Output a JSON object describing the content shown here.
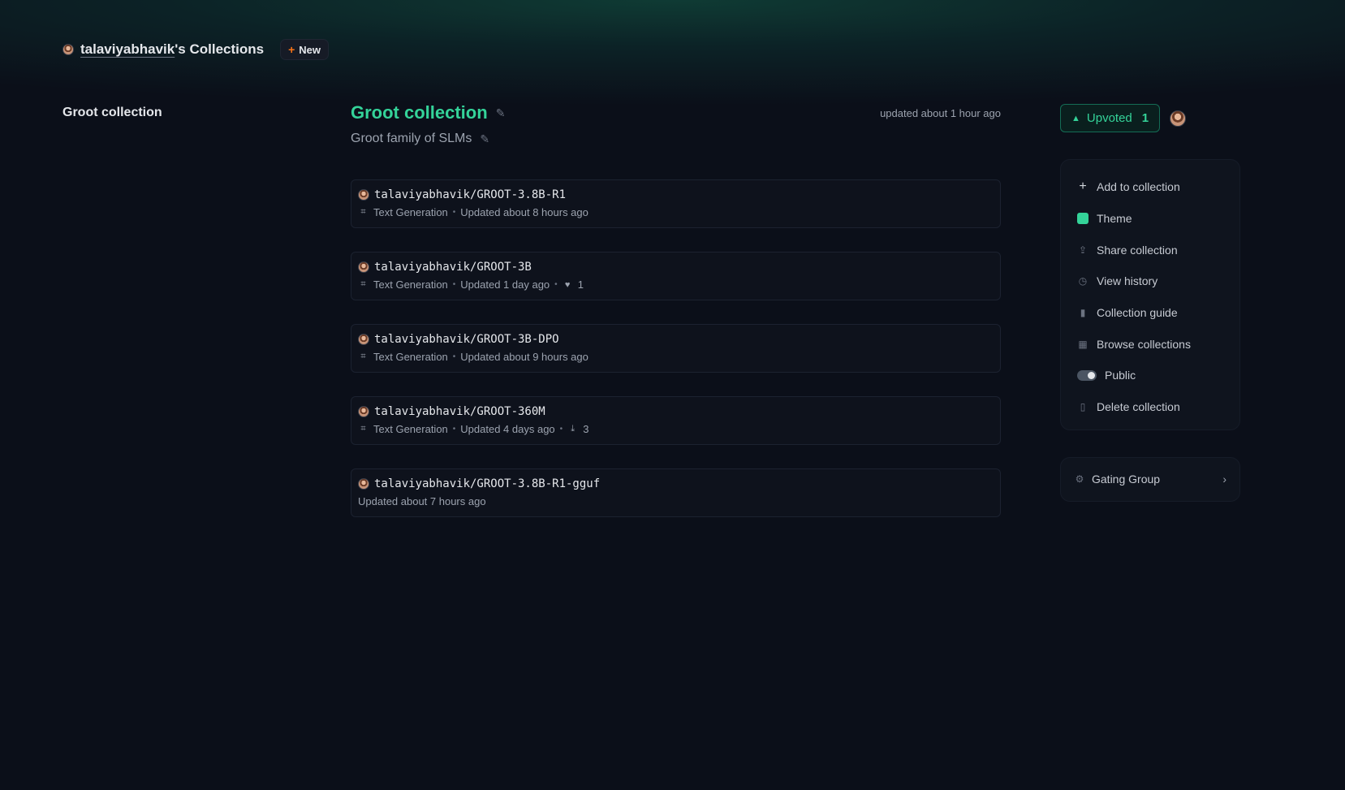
{
  "header": {
    "username": "talaviyabhavik",
    "title_suffix": "'s Collections",
    "new_label": "New"
  },
  "sidebar": {
    "collections": [
      "Groot collection"
    ]
  },
  "collection": {
    "title": "Groot collection",
    "description": "Groot family of SLMs",
    "updated": "updated about 1 hour ago"
  },
  "items": [
    {
      "name": "talaviyabhavik/GROOT-3.8B-R1",
      "task": "Text Generation",
      "updated": "Updated about 8 hours ago"
    },
    {
      "name": "talaviyabhavik/GROOT-3B",
      "task": "Text Generation",
      "updated": "Updated 1 day ago",
      "likes": "1"
    },
    {
      "name": "talaviyabhavik/GROOT-3B-DPO",
      "task": "Text Generation",
      "updated": "Updated about 9 hours ago"
    },
    {
      "name": "talaviyabhavik/GROOT-360M",
      "task": "Text Generation",
      "updated": "Updated 4 days ago",
      "downloads": "3"
    },
    {
      "name": "talaviyabhavik/GROOT-3.8B-R1-gguf",
      "updated": "Updated about 7 hours ago"
    }
  ],
  "upvote": {
    "label": "Upvoted",
    "count": "1"
  },
  "menu": {
    "add": "Add to collection",
    "theme": "Theme",
    "share": "Share collection",
    "history": "View history",
    "guide": "Collection guide",
    "browse": "Browse collections",
    "public": "Public",
    "delete": "Delete collection"
  },
  "gating": {
    "label": "Gating Group"
  },
  "colors": {
    "accent": "#34d399",
    "background": "#0b0f19",
    "new_plus": "#f97316"
  },
  "icons": {
    "edit": "pencil-icon",
    "task": "tag-icon",
    "likes": "heart-icon",
    "downloads": "download-icon",
    "upvote": "triangle-up-icon",
    "gating": "gear-icon",
    "chevron": "chevron-right-icon"
  }
}
